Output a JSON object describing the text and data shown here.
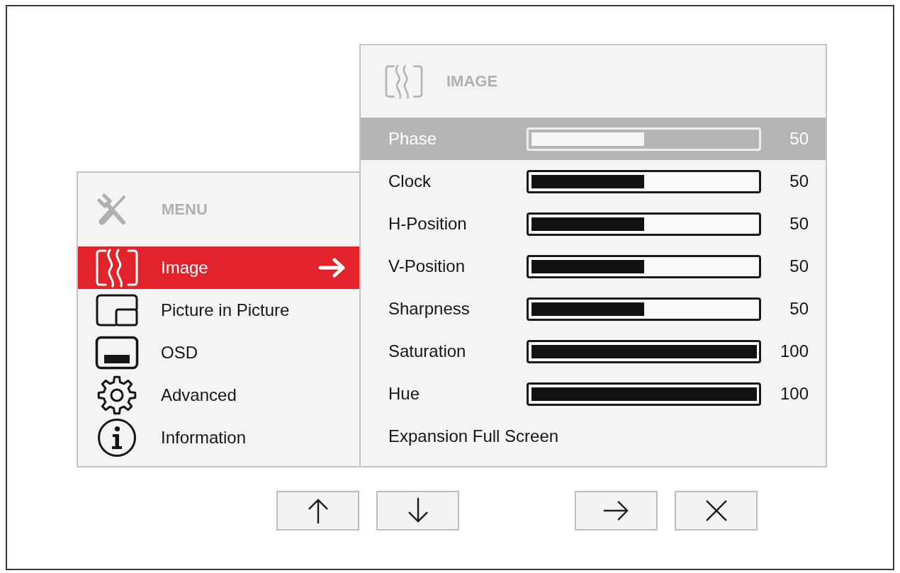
{
  "menu": {
    "title": "MENU",
    "items": [
      {
        "label": "Image",
        "kind": "image",
        "selected": true
      },
      {
        "label": "Picture in Picture",
        "kind": "pip",
        "selected": false
      },
      {
        "label": "OSD",
        "kind": "osd",
        "selected": false
      },
      {
        "label": "Advanced",
        "kind": "advanced",
        "selected": false
      },
      {
        "label": "Information",
        "kind": "information",
        "selected": false
      }
    ]
  },
  "submenu": {
    "title": "IMAGE",
    "items": [
      {
        "label": "Phase",
        "kind": "slider",
        "level": 0.5,
        "reading": "50",
        "selected": true
      },
      {
        "label": "Clock",
        "kind": "slider",
        "level": 0.5,
        "reading": "50",
        "selected": false
      },
      {
        "label": "H-Position",
        "kind": "slider",
        "level": 0.5,
        "reading": "50",
        "selected": false
      },
      {
        "label": "V-Position",
        "kind": "slider",
        "level": 0.5,
        "reading": "50",
        "selected": false
      },
      {
        "label": "Sharpness",
        "kind": "slider",
        "level": 0.5,
        "reading": "50",
        "selected": false
      },
      {
        "label": "Saturation",
        "kind": "slider",
        "level": 1,
        "reading": "100",
        "selected": false
      },
      {
        "label": "Hue",
        "kind": "slider",
        "level": 1,
        "reading": "100",
        "selected": false
      },
      {
        "label": "Expansion Full Screen",
        "kind": "option",
        "selected": false
      }
    ]
  },
  "button_groups": [
    [
      {
        "kind": "up"
      },
      {
        "kind": "down"
      }
    ],
    [
      {
        "kind": "enter"
      },
      {
        "kind": "close"
      }
    ]
  ]
}
